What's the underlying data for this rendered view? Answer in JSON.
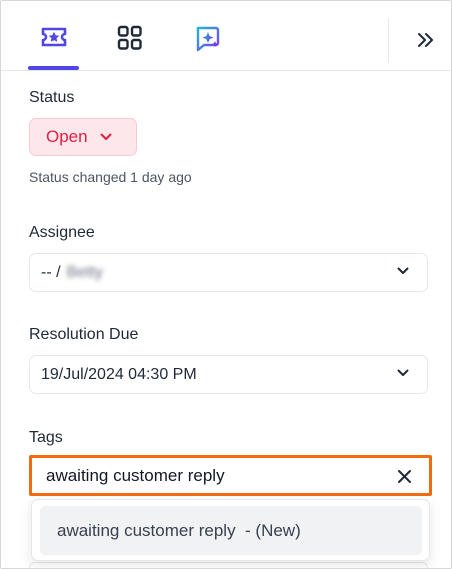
{
  "tabs": [
    {
      "icon": "ticket-icon",
      "active": true
    },
    {
      "icon": "apps-grid-icon",
      "active": false
    },
    {
      "icon": "ai-sparkle-icon",
      "active": false
    }
  ],
  "colors": {
    "accent": "#4f46e5",
    "status_bg": "#fde7ea",
    "status_text": "#e11d48",
    "focus_border": "#f26b0f"
  },
  "status": {
    "label": "Status",
    "value": "Open",
    "note": "Status changed 1 day ago"
  },
  "assignee": {
    "label": "Assignee",
    "value_prefix": "-- /",
    "value_name": "Betty"
  },
  "resolution": {
    "label": "Resolution Due",
    "value": "19/Jul/2024 04:30 PM"
  },
  "tags": {
    "label": "Tags",
    "input_value": "awaiting customer reply",
    "suggestion": "awaiting customer reply  - (New)"
  }
}
